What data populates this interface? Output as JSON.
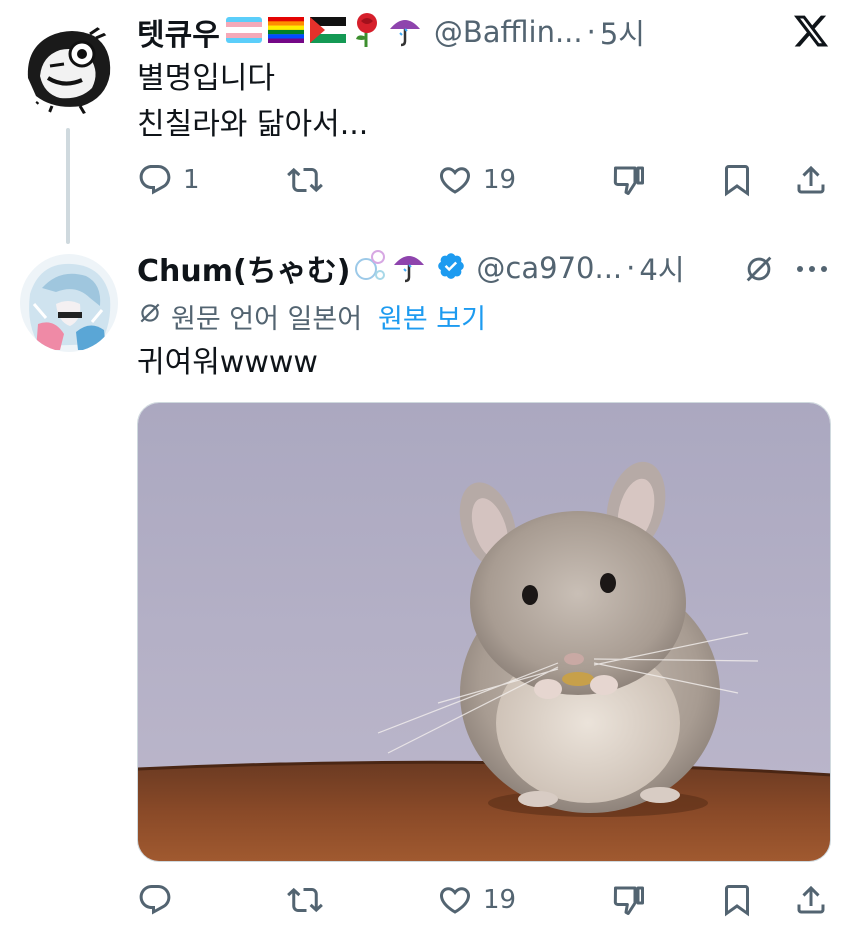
{
  "tweet1": {
    "display_name": "텟큐우",
    "handle": "@Bafflin...",
    "time": "5시",
    "text_line1": "별명입니다",
    "text_line2": "친칠라와 닮아서...",
    "reply_count": "1",
    "retweet_count": "",
    "like_count": "19",
    "platform_logo": "X"
  },
  "tweet2": {
    "display_name": "Chum(ちゃむ)",
    "handle": "@ca970...",
    "time": "4시",
    "translate_note": "원문 언어 일본어",
    "translate_link": "원본 보기",
    "text": "귀여워wwww",
    "reply_count": "",
    "retweet_count": "",
    "like_count": "19",
    "media_subject": "chinchilla"
  },
  "icons": {
    "flags": [
      "transgender-flag",
      "rainbow-flag",
      "palestine-flag"
    ],
    "emoji": [
      "rose",
      "umbrella",
      "bubbles",
      "verified-badge"
    ]
  },
  "colors": {
    "text": "#0f1419",
    "secondary": "#536471",
    "link": "#1d9bf0",
    "thread_line": "#cfd9de"
  }
}
